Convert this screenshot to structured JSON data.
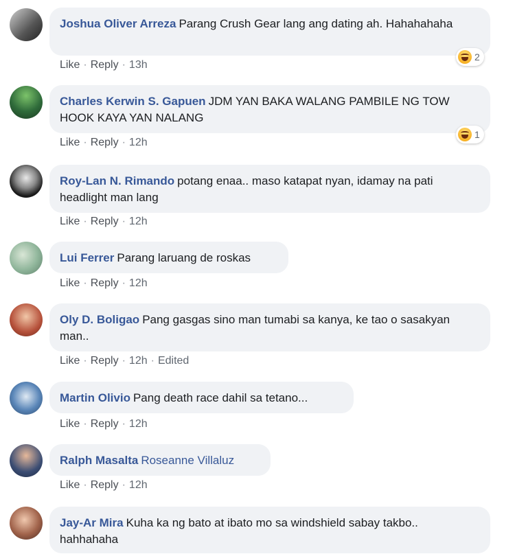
{
  "comments": [
    {
      "author": "Joshua Oliver Arreza",
      "text": "Parang Crush Gear lang ang dating ah. Hahahahaha",
      "like": "Like",
      "reply": "Reply",
      "time": "13h",
      "reaction_count": "2",
      "avatar_color": "#6b6b6b"
    },
    {
      "author": "Charles Kerwin S. Gapuen",
      "text": "JDM YAN BAKA WALANG PAMBILE NG TOW HOOK KAYA YAN NALANG",
      "like": "Like",
      "reply": "Reply",
      "time": "12h",
      "reaction_count": "1",
      "avatar_color": "#2f6b3a"
    },
    {
      "author": "Roy-Lan N. Rimando",
      "text": "potang enaa.. maso katapat nyan, idamay na pati headlight man lang",
      "like": "Like",
      "reply": "Reply",
      "time": "12h",
      "avatar_color": "#2a2a2a"
    },
    {
      "author": "Lui Ferrer",
      "text": "Parang laruang de roskas",
      "like": "Like",
      "reply": "Reply",
      "time": "12h",
      "avatar_color": "#8fb59a"
    },
    {
      "author": "Oly D. Boligao",
      "text": "Pang gasgas sino man tumabi sa kanya, ke tao o sasakyan man..",
      "like": "Like",
      "reply": "Reply",
      "time": "12h",
      "edited": "Edited",
      "avatar_color": "#b5503a"
    },
    {
      "author": "Martin Olivio",
      "text": "Pang death race dahil sa tetano...",
      "like": "Like",
      "reply": "Reply",
      "time": "12h",
      "avatar_color": "#5a86b8"
    },
    {
      "author": "Ralph Masalta",
      "mention": "Roseanne Villaluz",
      "like": "Like",
      "reply": "Reply",
      "time": "12h",
      "avatar_color": "#3b4d73"
    },
    {
      "author": "Jay-Ar Mira",
      "text": "Kuha ka ng bato at ibato mo sa windshield sabay takbo.. hahhahaha",
      "avatar_color": "#a0624a"
    }
  ]
}
